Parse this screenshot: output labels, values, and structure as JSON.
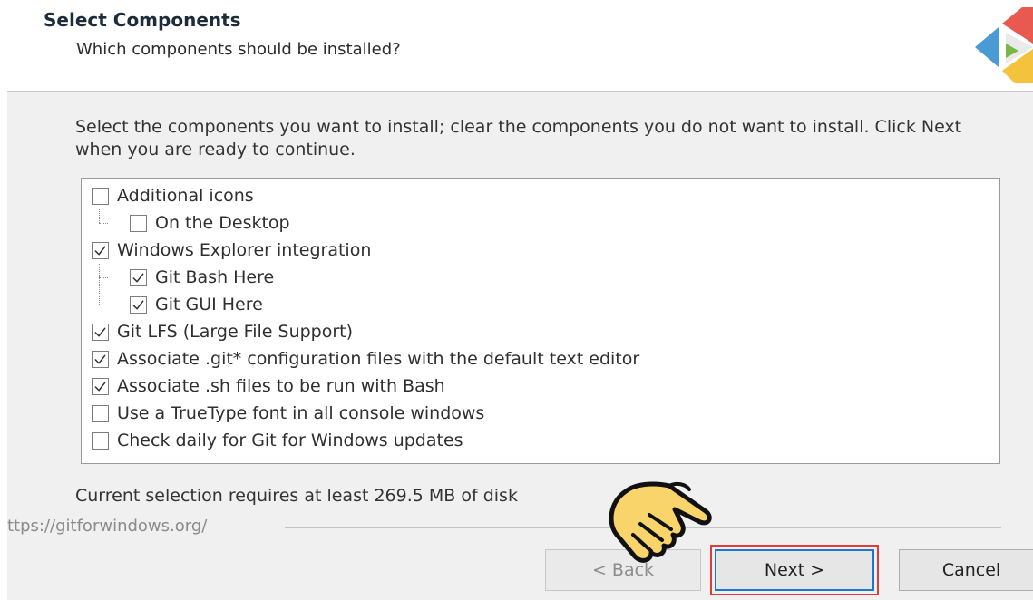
{
  "header": {
    "title": "Select Components",
    "subtitle": "Which components should be installed?",
    "logo_icon": "git-logo-icon"
  },
  "instructions": "Select the components you want to install; clear the components you do not want to install. Click Next when you are ready to continue.",
  "components": [
    {
      "label": "Additional icons",
      "checked": false,
      "level": 0
    },
    {
      "label": "On the Desktop",
      "checked": false,
      "level": 1
    },
    {
      "label": "Windows Explorer integration",
      "checked": true,
      "level": 0
    },
    {
      "label": "Git Bash Here",
      "checked": true,
      "level": 1
    },
    {
      "label": "Git GUI Here",
      "checked": true,
      "level": 1
    },
    {
      "label": "Git LFS (Large File Support)",
      "checked": true,
      "level": 0
    },
    {
      "label": "Associate .git* configuration files with the default text editor",
      "checked": true,
      "level": 0
    },
    {
      "label": "Associate .sh files to be run with Bash",
      "checked": true,
      "level": 0
    },
    {
      "label": "Use a TrueType font in all console windows",
      "checked": false,
      "level": 0
    },
    {
      "label": "Check daily for Git for Windows updates",
      "checked": false,
      "level": 0
    }
  ],
  "disk_requirement": "Current selection requires at least 269.5 MB of disk",
  "url": "ttps://gitforwindows.org/",
  "buttons": {
    "back": "< Back",
    "next": "Next >",
    "cancel": "Cancel"
  },
  "colors": {
    "accent": "#1a78d2",
    "highlight": "#e23b3b",
    "window_bg": "#f0f0f0"
  },
  "pointer_icon": "pointing-hand-icon"
}
